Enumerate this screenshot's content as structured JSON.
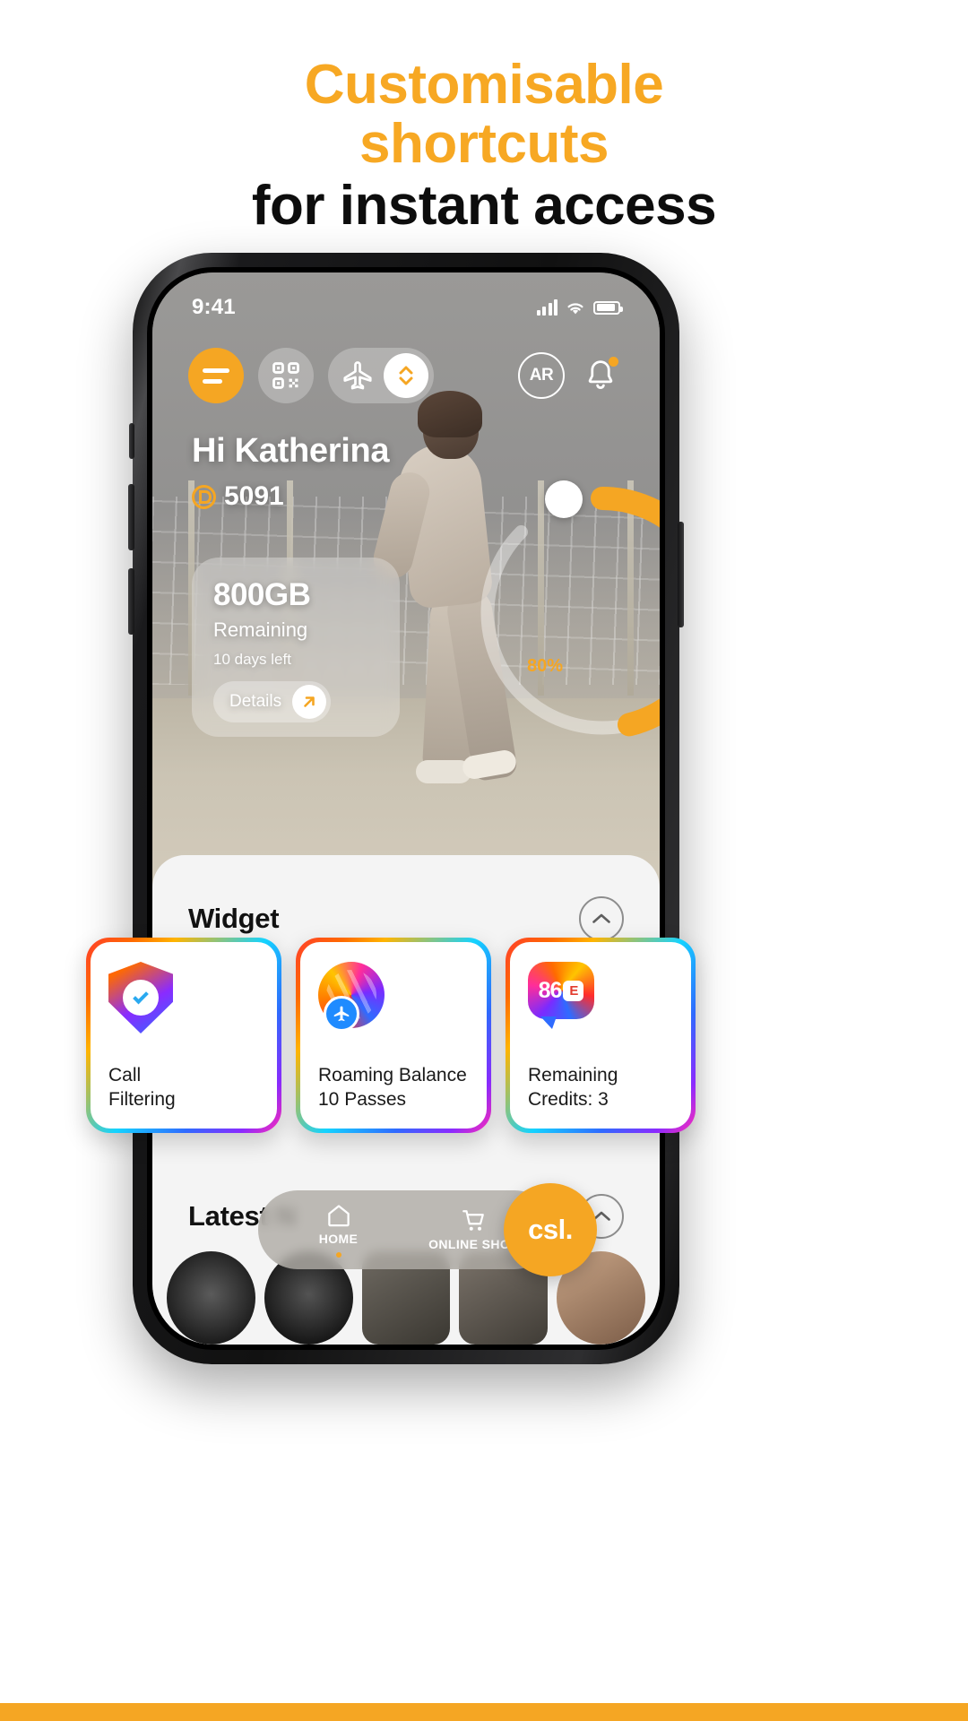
{
  "headline": {
    "line1": "Customisable",
    "line2": "shortcuts",
    "line3": "for instant access",
    "accent_color": "#F7A823",
    "dark_color": "#0d0d0d"
  },
  "phone": {
    "status_bar": {
      "time": "9:41",
      "signal_icon": "cellular-signal-icon",
      "wifi_icon": "wifi-icon",
      "battery_icon": "battery-icon"
    },
    "quick_actions": [
      {
        "name": "menu",
        "icon": "hamburger-menu-icon",
        "label": ""
      },
      {
        "name": "qr",
        "icon": "qr-code-icon",
        "label": ""
      },
      {
        "name": "roaming",
        "icon": "airplane-icon",
        "label": ""
      },
      {
        "name": "toggle",
        "icon": "up-down-chevron-icon",
        "label": ""
      },
      {
        "name": "ar",
        "icon": "ar-icon",
        "label": "AR"
      },
      {
        "name": "notifications",
        "icon": "bell-icon",
        "label": ""
      }
    ],
    "greeting": {
      "name": "Hi Katherina",
      "points_icon": "club-points-icon",
      "points": "5091"
    },
    "data_card": {
      "amount": "800GB",
      "status": "Remaining",
      "days_left": "10 days left",
      "details_label": "Details",
      "details_icon": "arrow-up-right-icon"
    },
    "gauge": {
      "percent_label": "80%",
      "percent_value": 80,
      "track_color": "#F5A623"
    },
    "sheet": {
      "widget_title": "Widget",
      "widget_collapse_icon": "chevron-up-icon",
      "news_title": "Latest N",
      "news_collapse_icon": "chevron-up-icon"
    },
    "bottom_nav": {
      "items": [
        {
          "label": "HOME",
          "icon": "home-icon",
          "active": true
        },
        {
          "label": "ONLINE\nSHOP",
          "icon": "cart-icon",
          "active": false
        }
      ],
      "fab_label": "csl.",
      "fab_color": "#F5A623"
    }
  },
  "shortcut_cards": [
    {
      "icon": "shield-check-icon",
      "label": "Call\nFiltering"
    },
    {
      "icon": "globe-plane-icon",
      "label": "Roaming Balance\n10 Passes"
    },
    {
      "icon": "credits-bubble-icon",
      "label": "Remaining\nCredits: 3",
      "badge_number": "86",
      "badge_letter": "E"
    }
  ]
}
